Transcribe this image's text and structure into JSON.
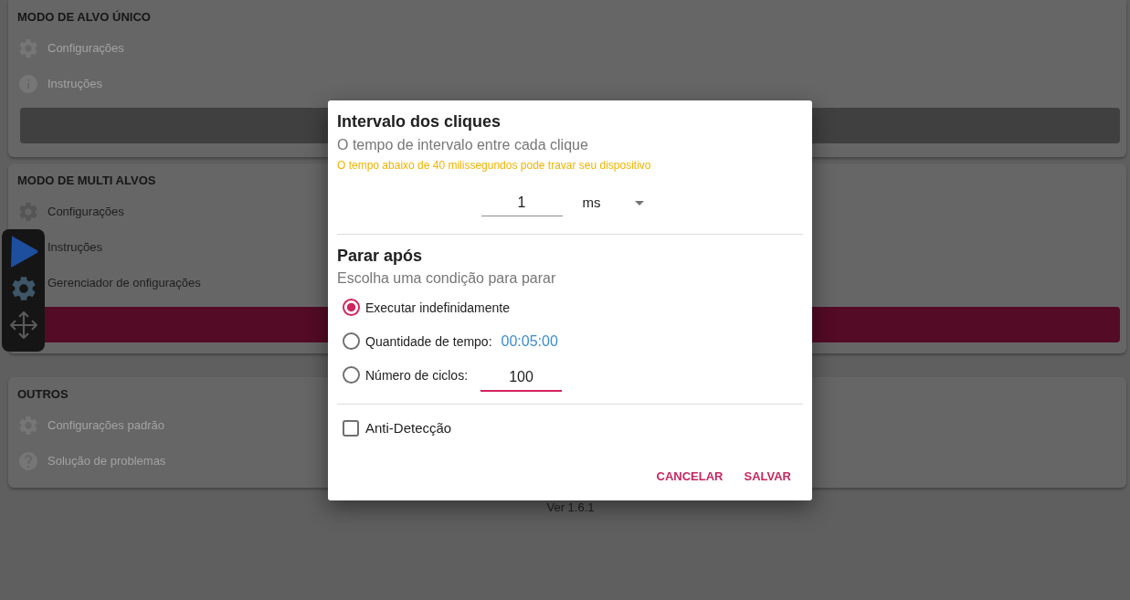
{
  "sections": [
    {
      "title": "MODO DE ALVO ÚNICO",
      "items": [
        {
          "label": "Configurações",
          "kind": "settings",
          "disabled": true
        },
        {
          "label": "Instruções",
          "kind": "info",
          "disabled": true
        }
      ],
      "action_bar": {
        "disabled": true
      }
    },
    {
      "title": "MODO DE MULTI ALVOS",
      "items": [
        {
          "label": "Configurações",
          "kind": "settings",
          "disabled": false
        },
        {
          "label": "Instruções",
          "disabled": false
        },
        {
          "label": "Gerenciador de onfigurações",
          "disabled": false
        }
      ],
      "action_bar": {
        "disabled": false
      }
    },
    {
      "title": "OUTROS",
      "items": [
        {
          "label": "Configurações padrão",
          "kind": "settings",
          "disabled": true
        },
        {
          "label": "Solução de problemas",
          "kind": "help",
          "disabled": true
        }
      ]
    }
  ],
  "version": "Ver 1.6.1",
  "dialog": {
    "interval": {
      "title": "Intervalo dos cliques",
      "subtitle": "O tempo de intervalo entre cada clique",
      "warning": "O tempo abaixo de 40 milissegundos pode travar seu dispositivo",
      "value": "1",
      "focused": false,
      "unit": "ms"
    },
    "stop_after": {
      "title": "Parar após",
      "subtitle": "Escolha uma condição para parar",
      "options": [
        {
          "label": "Executar indefinidamente",
          "kind": "plain",
          "selected": true
        },
        {
          "label": "Quantidade de tempo:",
          "kind": "time",
          "value": "00:05:00",
          "selected": false
        },
        {
          "label": "Número de ciclos:",
          "kind": "count",
          "value": "100",
          "focused": true,
          "selected": false
        }
      ]
    },
    "anti_detection": {
      "label": "Anti-Detecção",
      "checked": false
    },
    "buttons": [
      "CANCELAR",
      "SALVAR"
    ]
  }
}
